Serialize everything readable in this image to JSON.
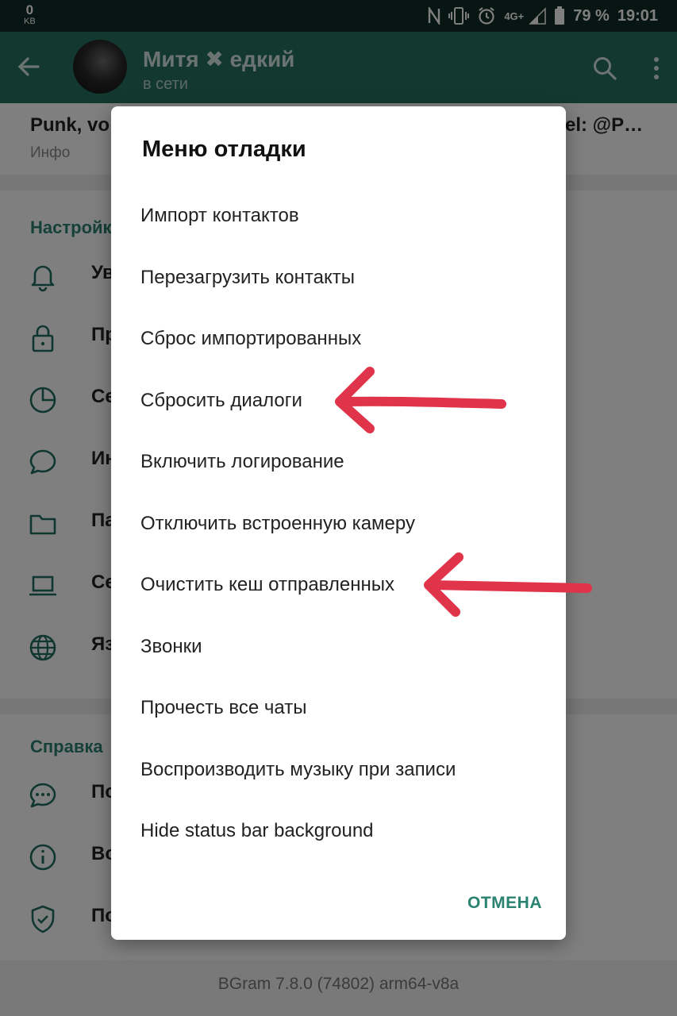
{
  "status_bar": {
    "data_rate": "0",
    "data_unit": "KB",
    "network": "4G+",
    "battery": "79 %",
    "time": "19:01"
  },
  "header": {
    "chat_name": "Митя ✖ едкий",
    "chat_status": "в сети"
  },
  "profile": {
    "bio_left": "Punk, vo",
    "bio_right": "el: @P…",
    "bio_sub": "Инфо"
  },
  "settings": {
    "section_title": "Настройки",
    "items": [
      {
        "label": "Ув",
        "icon": "bell-icon"
      },
      {
        "label": "Пр",
        "icon": "lock-icon"
      },
      {
        "label": "Се",
        "icon": "pie-chart-icon"
      },
      {
        "label": "Ин",
        "icon": "chat-bubble-icon"
      },
      {
        "label": "Па",
        "icon": "folder-icon"
      },
      {
        "label": "Се",
        "icon": "laptop-icon"
      },
      {
        "label": "Яз",
        "icon": "globe-icon"
      }
    ]
  },
  "help": {
    "section_title": "Справка",
    "items": [
      {
        "label": "По",
        "icon": "chat-dots-icon"
      },
      {
        "label": "Во",
        "icon": "info-icon"
      },
      {
        "label": "По",
        "icon": "shield-check-icon"
      }
    ]
  },
  "footer": {
    "version": "BGram 7.8.0 (74802) arm64-v8a"
  },
  "dialog": {
    "title": "Меню отладки",
    "items": [
      "Импорт контактов",
      "Перезагрузить контакты",
      "Сброс импортированных",
      "Сбросить диалоги",
      "Включить логирование",
      "Отключить встроенную камеру",
      "Очистить кеш отправленных",
      "Звонки",
      "Прочесть все чаты",
      "Воспроизводить музыку при записи",
      "Hide status bar background"
    ],
    "cancel_label": "ОТМЕНА"
  },
  "colors": {
    "header": "#27705f",
    "accent": "#2a8270",
    "annotation_arrow": "#e0344a"
  }
}
